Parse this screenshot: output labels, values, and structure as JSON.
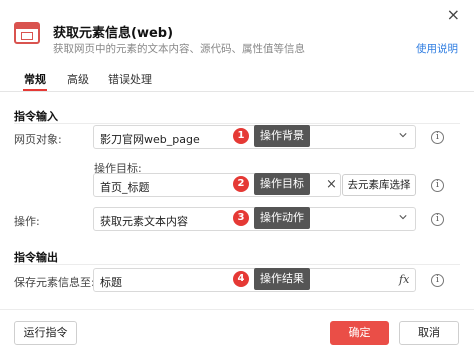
{
  "header": {
    "title": "获取元素信息(web)",
    "subtitle": "获取网页中的元素的文本内容、源代码、属性值等信息",
    "help_link": "使用说明",
    "close": "×"
  },
  "tabs": [
    {
      "label": "常规",
      "active": true
    },
    {
      "label": "高级",
      "active": false
    },
    {
      "label": "错误处理",
      "active": false
    }
  ],
  "input_section": {
    "title": "指令输入",
    "webpage": {
      "label": "网页对象:",
      "value": "影刀官网web_page"
    },
    "target": {
      "label": "操作目标:",
      "value": "首页_标题",
      "clear": "×",
      "library_button": "去元素库选择"
    },
    "operation": {
      "label": "操作:",
      "value": "获取元素文本内容"
    }
  },
  "output_section": {
    "title": "指令输出",
    "save": {
      "label": "保存元素信息至:",
      "value": "标题",
      "fx": "fx"
    }
  },
  "annotations": [
    {
      "number": "1",
      "text": "操作背景"
    },
    {
      "number": "2",
      "text": "操作目标"
    },
    {
      "number": "3",
      "text": "操作动作"
    },
    {
      "number": "4",
      "text": "操作结果"
    }
  ],
  "info_icon": "i",
  "footer": {
    "run_button": "运行指令",
    "ok_button": "确定",
    "cancel_button": "取消"
  },
  "colors": {
    "accent": "#e53935",
    "primary_button": "#ea4e47",
    "link": "#2f7de1",
    "annotation_box": "#555555"
  }
}
